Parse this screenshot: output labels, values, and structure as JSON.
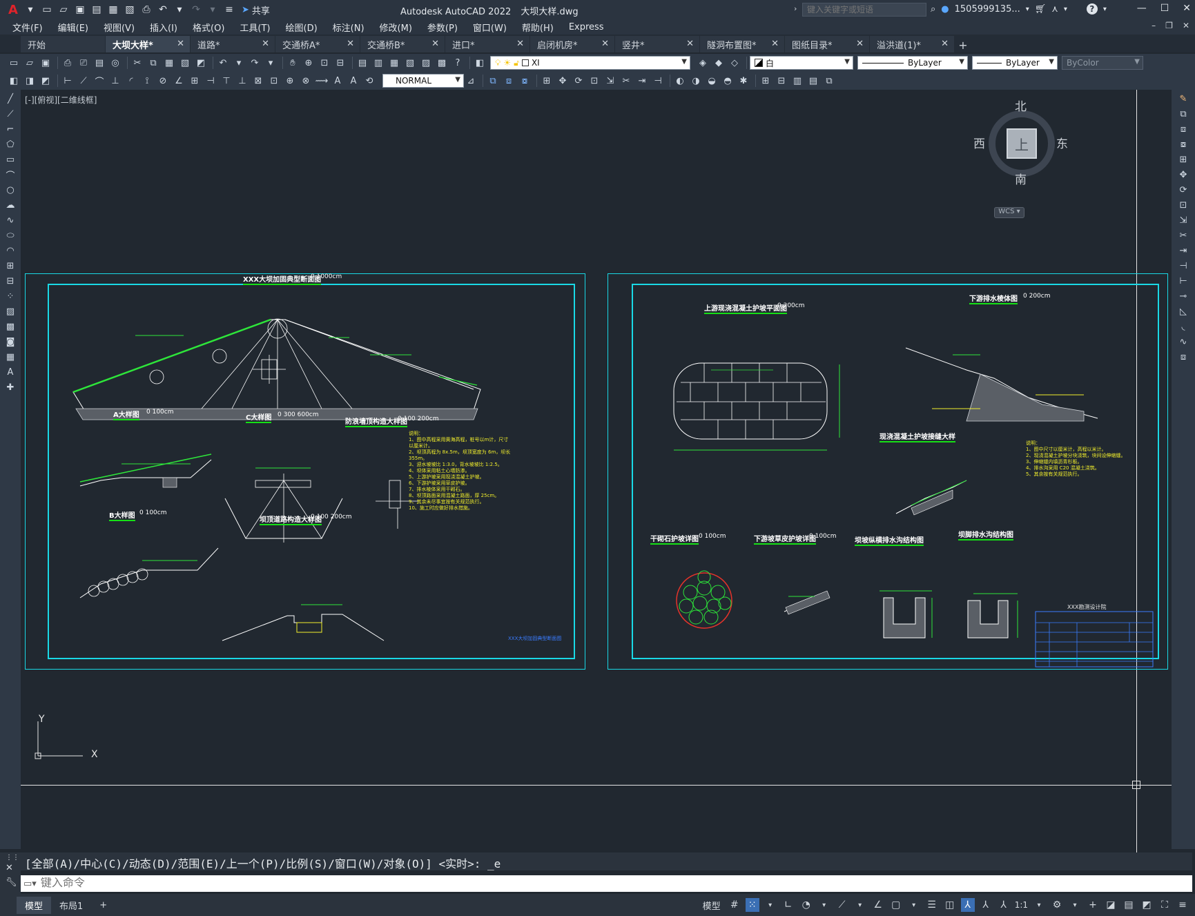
{
  "app": {
    "title": "Autodesk AutoCAD 2022",
    "filename": "大坝大样.dwg",
    "logo_letter": "A",
    "share_label": "共享",
    "search_placeholder": "键入关键字或短语",
    "user": "1505999135...",
    "help": "?"
  },
  "menu": [
    "文件(F)",
    "编辑(E)",
    "视图(V)",
    "插入(I)",
    "格式(O)",
    "工具(T)",
    "绘图(D)",
    "标注(N)",
    "修改(M)",
    "参数(P)",
    "窗口(W)",
    "帮助(H)",
    "Express"
  ],
  "file_tabs": [
    {
      "label": "开始",
      "active": false,
      "closable": false
    },
    {
      "label": "大坝大样*",
      "active": true,
      "closable": true
    },
    {
      "label": "道路*",
      "active": false,
      "closable": true
    },
    {
      "label": "交通桥A*",
      "active": false,
      "closable": true
    },
    {
      "label": "交通桥B*",
      "active": false,
      "closable": true
    },
    {
      "label": "进口*",
      "active": false,
      "closable": true
    },
    {
      "label": "启闭机房*",
      "active": false,
      "closable": true
    },
    {
      "label": "竖井*",
      "active": false,
      "closable": true
    },
    {
      "label": "隧洞布置图*",
      "active": false,
      "closable": true
    },
    {
      "label": "图纸目录*",
      "active": false,
      "closable": true
    },
    {
      "label": "溢洪道(1)*",
      "active": false,
      "closable": true
    }
  ],
  "properties": {
    "layer": "XI",
    "color": "白",
    "linetype": "ByLayer",
    "lineweight": "ByLayer",
    "plotstyle": "ByColor",
    "dimstyle": "NORMAL"
  },
  "viewport": {
    "label": "[-][俯视][二维线框]",
    "compass": {
      "north": "北",
      "south": "南",
      "east": "东",
      "west": "西",
      "face": "上"
    },
    "wcs": "WCS",
    "ucs_y": "Y",
    "ucs_x": "X"
  },
  "sheet_left": {
    "main_title": "XXX大坝加固典型断面图",
    "main_scale": "0    1000cm",
    "detail_a": "A大样图",
    "detail_a_scale": "0    100cm",
    "detail_c": "C大样图",
    "detail_c_scale": "0  300  600cm",
    "detail_wall": "防浪墙顶构造大样图",
    "detail_wall_scale": "0  100  200cm",
    "detail_b": "B大样图",
    "detail_b_scale": "0    100cm",
    "detail_crest": "坝顶道路构造大样图",
    "detail_crest_scale": "0  100  200cm",
    "notes_title": "说明：",
    "notes": [
      "1、图中高程采用黄海高程，桩号以m计，尺寸以厘米计。",
      "2、坝顶高程为 8x.5m，坝顶宽度为 6m，坝长 355m。",
      "3、迎水坡坡比 1:3.0，背水坡坡比 1:2.5。",
      "4、坝体采用粘土心墙防渗。",
      "5、上游护坡采用现浇混凝土护坡。",
      "6、下游护坡采用草皮护坡。",
      "7、排水棱体采用干砌石。",
      "8、坝顶路面采用混凝土路面，厚 25cm。",
      "9、其余未尽事宜按有关规范执行。",
      "10、施工时应做好排水措施。"
    ],
    "footer": "XXX大坝加固典型断面图"
  },
  "sheet_right": {
    "plan_title": "上游现浇混凝土护坡平面图",
    "plan_scale": "0    200cm",
    "drain_title": "下游排水棱体图",
    "drain_scale": "0    200cm",
    "slab_title": "现浇混凝土护坡接缝大样",
    "riprap_title": "干砌石护坡详图",
    "riprap_scale": "0    100cm",
    "grass_title": "下游坡草皮护坡详图",
    "grass_scale": "0    100cm",
    "ditch_title": "坝坡纵横排水沟结构图",
    "toe_title": "坝脚排水沟结构图",
    "notes_title": "说明：",
    "notes": [
      "1、图中尺寸以厘米计，高程以米计。",
      "2、现浇混凝土护坡分块浇筑，块间设伸缩缝。",
      "3、伸缩缝内填沥青杉板。",
      "4、排水沟采用 C20 混凝土浇筑。",
      "5、其余按有关规范执行。"
    ],
    "titleblock_org": "XXX勘测设计院"
  },
  "command": {
    "history": "[全部(A)/中心(C)/动态(D)/范围(E)/上一个(P)/比例(S)/窗口(W)/对象(O)] <实时>: _e",
    "placeholder": "键入命令"
  },
  "status": {
    "layout_tabs": [
      "模型",
      "布局1"
    ],
    "model_label": "模型",
    "scale": "1:1"
  }
}
